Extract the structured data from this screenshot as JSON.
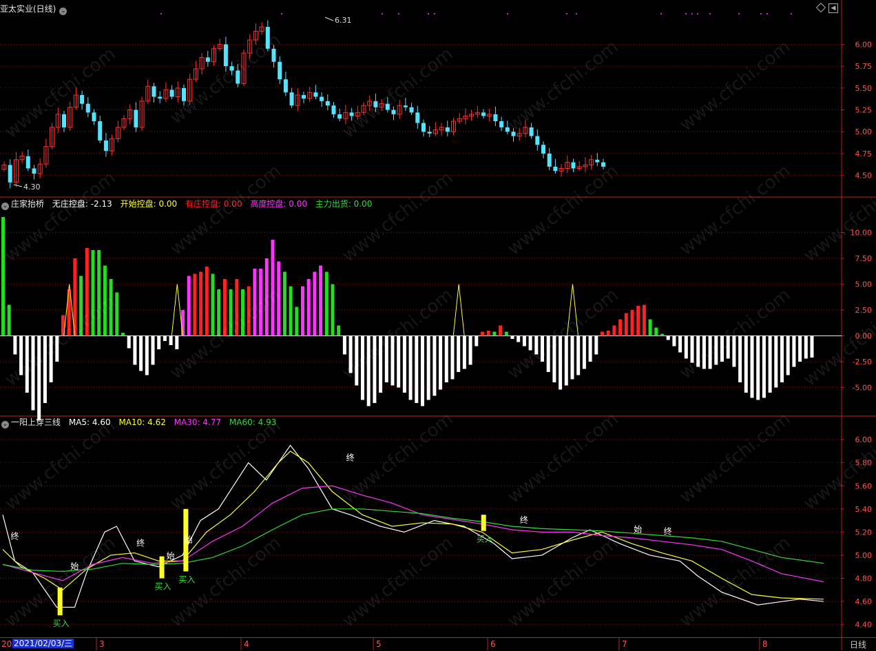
{
  "app": {
    "period_label": "日线"
  },
  "panel1": {
    "title": "亚太实业(日线)",
    "high_label": "6.31",
    "low_label": "4.30",
    "yticks": [
      "6.00",
      "5.75",
      "5.50",
      "5.25",
      "5.00",
      "4.75",
      "4.50"
    ]
  },
  "panel2": {
    "title": "庄家抬桥",
    "items": [
      {
        "label": "无庄控盘: -2.13",
        "color": "#ffffff"
      },
      {
        "label": "开始控盘: 0.00",
        "color": "#ffff33"
      },
      {
        "label": "有庄控盘: 0.00",
        "color": "#ff2222"
      },
      {
        "label": "高度控盘: 0.00",
        "color": "#ff33ff"
      },
      {
        "label": "主力出货: 0.00",
        "color": "#33dd33"
      }
    ],
    "yticks": [
      "10.00",
      "7.50",
      "5.00",
      "2.50",
      "0.00",
      "-2.50",
      "-5.00"
    ]
  },
  "panel3": {
    "title": "一阳上穿三线",
    "items": [
      {
        "label": "MA5: 4.60",
        "color": "#ffffff"
      },
      {
        "label": "MA10: 4.62",
        "color": "#ffff33"
      },
      {
        "label": "MA30: 4.77",
        "color": "#ff33ff"
      },
      {
        "label": "MA60: 4.93",
        "color": "#33dd33"
      }
    ],
    "yticks": [
      "6.00",
      "5.80",
      "5.60",
      "5.40",
      "5.20",
      "5.00",
      "4.80",
      "4.60",
      "4.40"
    ],
    "signals": {
      "buy": "买入",
      "start": "始",
      "end": "终"
    }
  },
  "xaxis": {
    "selected_date": "2021/02/03/三",
    "prefix": "20",
    "months": [
      "3",
      "4",
      "5",
      "6",
      "7",
      "8"
    ]
  },
  "chart_data": [
    {
      "type": "candlestick",
      "title": "亚太实业(日线)",
      "ylim": [
        4.3,
        6.35
      ],
      "closes": [
        4.62,
        4.42,
        4.68,
        4.72,
        4.58,
        4.52,
        4.63,
        4.83,
        5.05,
        5.2,
        5.05,
        5.28,
        5.42,
        5.32,
        5.22,
        5.12,
        4.9,
        4.78,
        4.92,
        5.05,
        5.15,
        5.25,
        5.05,
        5.35,
        5.52,
        5.4,
        5.38,
        5.48,
        5.4,
        5.5,
        5.35,
        5.6,
        5.72,
        5.85,
        5.8,
        5.95,
        6.0,
        5.75,
        5.7,
        5.55,
        5.9,
        6.05,
        6.15,
        6.2,
        5.95,
        5.8,
        5.6,
        5.45,
        5.3,
        5.42,
        5.38,
        5.45,
        5.4,
        5.35,
        5.3,
        5.2,
        5.15,
        5.22,
        5.18,
        5.22,
        5.3,
        5.35,
        5.28,
        5.32,
        5.25,
        5.2,
        5.3,
        5.28,
        5.22,
        5.1,
        5.0,
        4.98,
        5.02,
        5.05,
        5.0,
        5.12,
        5.15,
        5.18,
        5.2,
        5.22,
        5.18,
        5.2,
        5.12,
        5.05,
        5.0,
        4.95,
        4.98,
        5.05,
        4.95,
        4.85,
        4.75,
        4.6,
        4.55,
        4.58,
        4.65,
        4.58,
        4.6,
        4.62,
        4.68,
        4.65,
        4.6
      ],
      "high": 6.31,
      "low": 4.3
    },
    {
      "type": "bar",
      "title": "庄家抬桥",
      "ylim": [
        -7.5,
        12.5
      ],
      "series": [
        {
          "name": "无庄控盘",
          "color": "#ffffff"
        },
        {
          "name": "开始控盘",
          "color": "#ffff33"
        },
        {
          "name": "有庄控盘",
          "color": "#ff2222"
        },
        {
          "name": "高度控盘",
          "color": "#ff33ff"
        },
        {
          "name": "主力出货",
          "color": "#33dd33"
        }
      ],
      "bars": [
        [
          11.5,
          "g"
        ],
        [
          3,
          "g"
        ],
        [
          -1.8,
          "w"
        ],
        [
          -3.8,
          "w"
        ],
        [
          -5.5,
          "w"
        ],
        [
          -7.2,
          "w"
        ],
        [
          -8.2,
          "w"
        ],
        [
          -6.5,
          "w"
        ],
        [
          -4.5,
          "w"
        ],
        [
          -2.5,
          "w"
        ],
        [
          2,
          "r"
        ],
        [
          4.5,
          "r"
        ],
        [
          7.5,
          "r"
        ],
        [
          5.8,
          "g"
        ],
        [
          8.5,
          "r"
        ],
        [
          8.3,
          "g"
        ],
        [
          8.3,
          "g"
        ],
        [
          6.8,
          "g"
        ],
        [
          5.5,
          "g"
        ],
        [
          4.2,
          "g"
        ],
        [
          0.3,
          "g"
        ],
        [
          -1.2,
          "w"
        ],
        [
          -2.8,
          "w"
        ],
        [
          -3.4,
          "w"
        ],
        [
          -3.8,
          "w"
        ],
        [
          -2.8,
          "w"
        ],
        [
          -1.3,
          "w"
        ],
        [
          -0.5,
          "w"
        ],
        [
          -0.9,
          "w"
        ],
        [
          -1.3,
          "w"
        ],
        [
          2.5,
          "m"
        ],
        [
          5.8,
          "m"
        ],
        [
          6,
          "r"
        ],
        [
          6.2,
          "r"
        ],
        [
          6.7,
          "r"
        ],
        [
          6,
          "g"
        ],
        [
          4.5,
          "g"
        ],
        [
          5.5,
          "r"
        ],
        [
          4.5,
          "g"
        ],
        [
          5.5,
          "r"
        ],
        [
          4.5,
          "g"
        ],
        [
          4.8,
          "r"
        ],
        [
          6.5,
          "m"
        ],
        [
          6.5,
          "m"
        ],
        [
          7.5,
          "m"
        ],
        [
          9.3,
          "m"
        ],
        [
          7.2,
          "m"
        ],
        [
          6.2,
          "g"
        ],
        [
          4.8,
          "g"
        ],
        [
          2.8,
          "g"
        ],
        [
          4.8,
          "m"
        ],
        [
          5.5,
          "m"
        ],
        [
          6.2,
          "m"
        ],
        [
          6.8,
          "m"
        ],
        [
          6.2,
          "g"
        ],
        [
          5,
          "g"
        ],
        [
          1,
          "g"
        ],
        [
          -1.8,
          "w"
        ],
        [
          -3.6,
          "w"
        ],
        [
          -4.8,
          "w"
        ],
        [
          -6.2,
          "w"
        ],
        [
          -6.8,
          "w"
        ],
        [
          -6.5,
          "w"
        ],
        [
          -5.5,
          "w"
        ],
        [
          -4.5,
          "w"
        ],
        [
          -4.8,
          "w"
        ],
        [
          -5,
          "w"
        ],
        [
          -5.5,
          "w"
        ],
        [
          -6.2,
          "w"
        ],
        [
          -6.5,
          "w"
        ],
        [
          -6.8,
          "w"
        ],
        [
          -6.2,
          "w"
        ],
        [
          -5.8,
          "w"
        ],
        [
          -5.2,
          "w"
        ],
        [
          -4.5,
          "w"
        ],
        [
          -4.2,
          "w"
        ],
        [
          -3.5,
          "w"
        ],
        [
          -3.2,
          "w"
        ],
        [
          -2.8,
          "w"
        ],
        [
          -1,
          "w"
        ],
        [
          0.4,
          "r"
        ],
        [
          0.5,
          "r"
        ],
        [
          0.4,
          "g"
        ],
        [
          1,
          "r"
        ],
        [
          0.4,
          "g"
        ],
        [
          -0.3,
          "w"
        ],
        [
          -0.6,
          "w"
        ],
        [
          -1,
          "w"
        ],
        [
          -1.4,
          "w"
        ],
        [
          -1.8,
          "w"
        ],
        [
          -2.5,
          "w"
        ],
        [
          -3.5,
          "w"
        ],
        [
          -4.5,
          "w"
        ],
        [
          -5.2,
          "w"
        ],
        [
          -4.8,
          "w"
        ],
        [
          -4.2,
          "w"
        ],
        [
          -3.8,
          "w"
        ],
        [
          -3.2,
          "w"
        ],
        [
          -2.5,
          "w"
        ],
        [
          -1.8,
          "w"
        ],
        [
          0.4,
          "r"
        ],
        [
          0.5,
          "r"
        ],
        [
          1,
          "r"
        ],
        [
          1.6,
          "r"
        ],
        [
          2.2,
          "r"
        ],
        [
          2.5,
          "r"
        ],
        [
          2.9,
          "r"
        ],
        [
          3,
          "r"
        ],
        [
          1.6,
          "g"
        ],
        [
          0.8,
          "g"
        ],
        [
          0.2,
          "g"
        ],
        [
          -0.4,
          "w"
        ],
        [
          -1,
          "w"
        ],
        [
          -1.6,
          "w"
        ],
        [
          -2.2,
          "w"
        ],
        [
          -2.6,
          "w"
        ],
        [
          -3,
          "w"
        ],
        [
          -3.2,
          "w"
        ],
        [
          -3.2,
          "w"
        ],
        [
          -2.8,
          "w"
        ],
        [
          -2.5,
          "w"
        ],
        [
          -2.2,
          "w"
        ],
        [
          -3,
          "w"
        ],
        [
          -4.5,
          "w"
        ],
        [
          -5.5,
          "w"
        ],
        [
          -6,
          "w"
        ],
        [
          -6.2,
          "w"
        ],
        [
          -6,
          "w"
        ],
        [
          -5.5,
          "w"
        ],
        [
          -5,
          "w"
        ],
        [
          -4.5,
          "w"
        ],
        [
          -3.8,
          "w"
        ],
        [
          -3,
          "w"
        ],
        [
          -2.5,
          "w"
        ],
        [
          -2.2,
          "w"
        ],
        [
          -2.1,
          "w"
        ]
      ],
      "peak_markers": [
        11,
        29,
        76,
        95
      ]
    },
    {
      "type": "line",
      "title": "一阳上穿三线",
      "ylim": [
        4.35,
        6.12
      ],
      "series": [
        {
          "name": "MA5",
          "color": "#ffffff",
          "x": [
            0,
            2,
            5,
            9,
            12,
            14,
            17,
            19,
            22,
            26,
            30,
            33,
            36,
            41,
            44,
            48,
            51,
            55,
            58,
            63,
            67,
            72,
            77,
            82,
            85,
            90,
            95,
            98,
            103,
            108,
            113,
            116,
            120,
            126,
            133,
            137
          ],
          "y": [
            5.35,
            4.95,
            4.85,
            4.55,
            4.55,
            4.85,
            5.2,
            5.25,
            4.95,
            4.9,
            5.0,
            5.3,
            5.4,
            5.8,
            5.65,
            5.95,
            5.75,
            5.4,
            5.35,
            5.25,
            5.2,
            5.3,
            5.25,
            5.1,
            4.97,
            5.0,
            5.15,
            5.22,
            5.1,
            5.0,
            4.95,
            4.82,
            4.68,
            4.57,
            4.62,
            4.6
          ]
        },
        {
          "name": "MA10",
          "color": "#ffff33",
          "x": [
            0,
            3,
            7,
            10,
            14,
            18,
            22,
            26,
            30,
            34,
            38,
            42,
            46,
            48,
            51,
            55,
            60,
            65,
            70,
            75,
            80,
            85,
            90,
            95,
            100,
            105,
            110,
            115,
            120,
            125,
            130,
            137
          ],
          "y": [
            5.05,
            4.9,
            4.8,
            4.7,
            4.88,
            5.0,
            5.02,
            4.95,
            4.95,
            5.2,
            5.35,
            5.55,
            5.8,
            5.9,
            5.8,
            5.55,
            5.35,
            5.25,
            5.28,
            5.27,
            5.2,
            5.02,
            5.05,
            5.13,
            5.2,
            5.1,
            5.02,
            4.95,
            4.8,
            4.66,
            4.63,
            4.62
          ]
        },
        {
          "name": "MA30",
          "color": "#ff33ff",
          "x": [
            0,
            5,
            10,
            15,
            20,
            25,
            30,
            35,
            40,
            45,
            50,
            55,
            60,
            65,
            70,
            75,
            80,
            85,
            90,
            95,
            100,
            105,
            110,
            115,
            120,
            125,
            130,
            137
          ],
          "y": [
            4.92,
            4.85,
            4.78,
            4.92,
            4.98,
            4.93,
            4.95,
            5.12,
            5.25,
            5.45,
            5.58,
            5.6,
            5.52,
            5.45,
            5.35,
            5.31,
            5.27,
            5.22,
            5.2,
            5.2,
            5.17,
            5.15,
            5.12,
            5.09,
            5.05,
            4.95,
            4.84,
            4.77
          ]
        },
        {
          "name": "MA60",
          "color": "#33dd33",
          "x": [
            0,
            5,
            10,
            15,
            20,
            25,
            30,
            35,
            40,
            45,
            50,
            55,
            60,
            65,
            70,
            75,
            80,
            85,
            90,
            95,
            100,
            105,
            110,
            115,
            120,
            125,
            130,
            137
          ],
          "y": [
            4.92,
            4.87,
            4.86,
            4.88,
            4.93,
            4.92,
            4.93,
            4.98,
            5.08,
            5.22,
            5.35,
            5.4,
            5.4,
            5.38,
            5.36,
            5.32,
            5.29,
            5.25,
            5.23,
            5.22,
            5.21,
            5.19,
            5.17,
            5.15,
            5.12,
            5.05,
            4.98,
            4.93
          ]
        }
      ]
    }
  ]
}
